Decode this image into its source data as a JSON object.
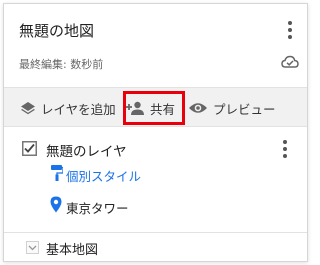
{
  "header": {
    "map_title": "無題の地図",
    "last_edited": "最終編集: 数秒前"
  },
  "toolbar": {
    "add_layer_label": "レイヤを追加",
    "share_label": "共有",
    "preview_label": "プレビュー"
  },
  "layer": {
    "name": "無題のレイヤ",
    "checked": true,
    "style_link": "個別スタイル",
    "place_name": "東京タワー"
  },
  "basemap": {
    "label": "基本地図"
  },
  "colors": {
    "highlight": "#e8000b",
    "link": "#1a73e8",
    "pin": "#1a73e8"
  },
  "icons": [
    "kebab-icon",
    "cloud-icon",
    "layers-icon",
    "add-person-icon",
    "eye-icon",
    "checkbox-icon",
    "paint-roller-icon",
    "map-pin-icon",
    "chevron-down-icon"
  ]
}
